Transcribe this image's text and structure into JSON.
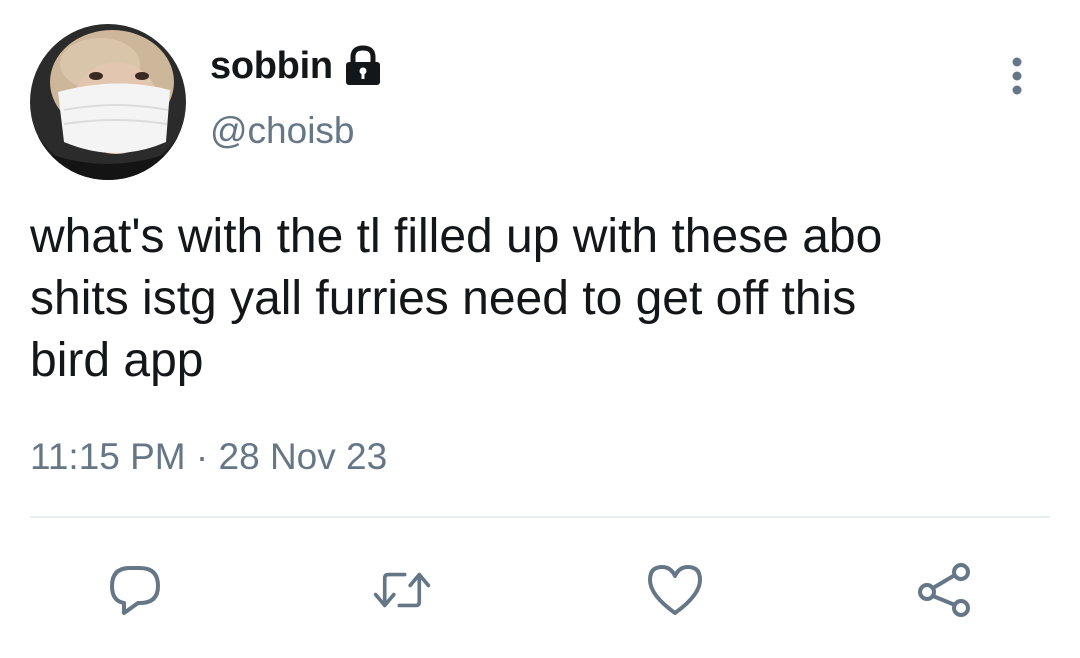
{
  "tweet": {
    "display_name": "sobbin",
    "handle": "@choisb",
    "text": "what's with the tl filled up with these abo\nshits istg yall furries need to get off this\nbird app",
    "time": "11:15 PM",
    "separator": "·",
    "date": "28 Nov 23",
    "locked": true
  },
  "icons": {
    "lock": "lock-icon",
    "more": "more-vertical-icon",
    "reply": "reply-icon",
    "retweet": "retweet-icon",
    "like": "heart-icon",
    "share": "share-icon"
  },
  "colors": {
    "text": "#14171a",
    "secondary": "#657786",
    "divider": "#e6ecf0"
  }
}
